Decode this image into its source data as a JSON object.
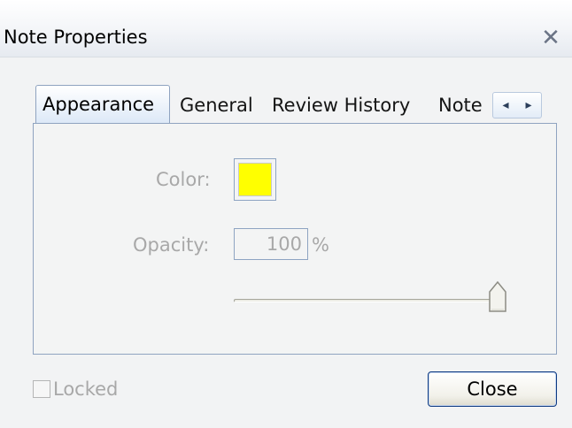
{
  "window": {
    "title": "Note Properties",
    "close_glyph": "✕"
  },
  "tabs": [
    {
      "label": "Appearance",
      "selected": true
    },
    {
      "label": "General",
      "selected": false
    },
    {
      "label": "Review History",
      "selected": false
    },
    {
      "label": "Note",
      "selected": false
    }
  ],
  "tab_scroller": {
    "left_glyph": "◂",
    "right_glyph": "▸"
  },
  "appearance": {
    "color_label": "Color:",
    "color_value": "#ffff00",
    "opacity_label": "Opacity:",
    "opacity_value": "100",
    "opacity_unit": "%",
    "opacity_slider_fraction": 1.0
  },
  "footer": {
    "locked_label": "Locked",
    "locked_checked": false,
    "close_label": "Close"
  }
}
